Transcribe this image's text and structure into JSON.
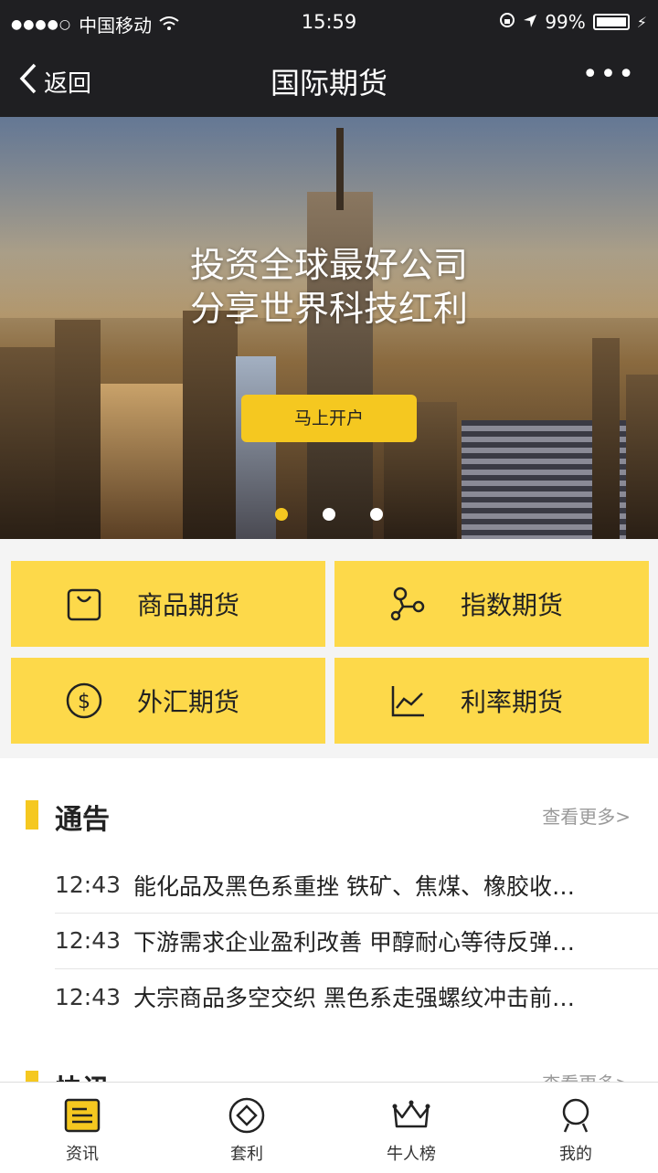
{
  "status": {
    "carrier": "中国移动",
    "time": "15:59",
    "battery": "99%"
  },
  "nav": {
    "back_label": "返回",
    "title": "国际期货",
    "more_label": "•••"
  },
  "banner": {
    "line1": "投资全球最好公司",
    "line2": "分享世界科技红利",
    "cta": "马上开户",
    "pages": 3,
    "active_page": 1
  },
  "categories": [
    {
      "label": "商品期货",
      "icon": "shopping-bag-icon"
    },
    {
      "label": "指数期货",
      "icon": "nodes-icon"
    },
    {
      "label": "外汇期货",
      "icon": "dollar-icon"
    },
    {
      "label": "利率期货",
      "icon": "line-chart-icon"
    }
  ],
  "notice": {
    "title": "通告",
    "more": "查看更多>",
    "items": [
      {
        "time": "12:43",
        "headline": "能化品及黑色系重挫 铁矿、焦煤、橡胶收…"
      },
      {
        "time": "12:43",
        "headline": "下游需求企业盈利改善 甲醇耐心等待反弹…"
      },
      {
        "time": "12:43",
        "headline": "大宗商品多空交织 黑色系走强螺纹冲击前…"
      }
    ]
  },
  "next_section": {
    "title": "快讯",
    "more": "查看更多>"
  },
  "tabs": [
    {
      "label": "资讯",
      "icon": "news-icon"
    },
    {
      "label": "套利",
      "icon": "diamond-icon"
    },
    {
      "label": "牛人榜",
      "icon": "crown-icon"
    },
    {
      "label": "我的",
      "icon": "user-icon"
    }
  ],
  "colors": {
    "accent": "#f5c820",
    "tile": "#fdd94a",
    "nav_bg": "#1f1f22"
  }
}
